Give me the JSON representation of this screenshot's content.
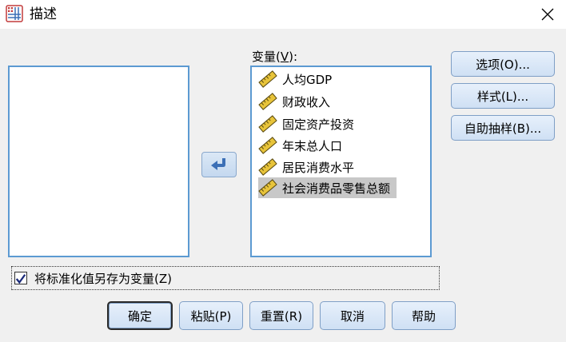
{
  "window": {
    "title": "描述",
    "close_icon": "close-icon",
    "app_icon": "spss-grid-icon"
  },
  "target_list": {
    "label_prefix": "变量(",
    "label_mnemonic": "V",
    "label_suffix": "):",
    "items": [
      {
        "label": "人均GDP",
        "icon": "ruler-icon",
        "selected": false
      },
      {
        "label": "财政收入",
        "icon": "ruler-icon",
        "selected": false
      },
      {
        "label": "固定资产投资",
        "icon": "ruler-icon",
        "selected": false
      },
      {
        "label": "年末总人口",
        "icon": "ruler-icon",
        "selected": false
      },
      {
        "label": "居民消费水平",
        "icon": "ruler-icon",
        "selected": false
      },
      {
        "label": "社会消费品零售总额",
        "icon": "ruler-icon",
        "selected": true
      }
    ]
  },
  "side_buttons": {
    "options": "选项(O)...",
    "style": "样式(L)...",
    "bootstrap": "自助抽样(B)..."
  },
  "checkbox": {
    "label": "将标准化值另存为变量(Z)",
    "checked": true
  },
  "bottom_buttons": {
    "ok": "确定",
    "paste": "粘贴(P)",
    "reset": "重置(R)",
    "cancel": "取消",
    "help": "帮助"
  },
  "colors": {
    "list_border": "#5c9ad2",
    "selected_bg": "#c8c8c8",
    "accent": "#3b6fb6"
  }
}
